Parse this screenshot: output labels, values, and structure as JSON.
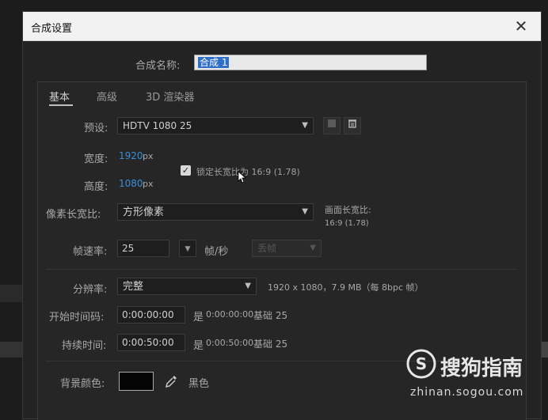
{
  "dialog": {
    "title": "合成设置",
    "close_symbol": "✕",
    "name_label": "合成名称:",
    "name_value": "合成 1"
  },
  "tabs": [
    {
      "label": "基本",
      "active": true
    },
    {
      "label": "高级",
      "active": false
    },
    {
      "label": "3D 渲染器",
      "active": false
    }
  ],
  "basic": {
    "preset_label": "预设:",
    "preset_value": "HDTV 1080 25",
    "width_label": "宽度:",
    "width_value": "1920",
    "height_label": "高度:",
    "height_value": "1080",
    "px": "px",
    "lock_checked": true,
    "lock_label": "锁定长宽比为 16:9 (1.78)",
    "pixel_aspect_label": "像素长宽比:",
    "pixel_aspect_value": "方形像素",
    "frame_aspect_label": "画面长宽比:",
    "frame_aspect_value": "16:9 (1.78)",
    "frame_rate_label": "帧速率:",
    "frame_rate_value": "25",
    "frame_rate_unit": "帧/秒",
    "drop_frame_value": "丢帧",
    "resolution_label": "分辨率:",
    "resolution_value": "完整",
    "resolution_info": "1920 x 1080，7.9 MB（每 8bpc 帧）",
    "start_tc_label": "开始时间码:",
    "start_tc_value": "0:00:00:00",
    "start_tc_info_is": "是",
    "start_tc_info_val": "0:00:00:00",
    "start_tc_base": "基础 25",
    "duration_label": "持续时间:",
    "duration_value": "0:00:50:00",
    "duration_info_is": "是",
    "duration_info_val": "0:00:50:00",
    "duration_base": "基础 25",
    "bg_color_label": "背景颜色:",
    "bg_color_hex": "#050505",
    "bg_color_name": "黑色"
  },
  "watermark": {
    "brand": "搜狗指南",
    "url": "zhinan.sogou.com"
  },
  "icons": [
    "close-icon",
    "chevron-down-icon",
    "save-preset-icon",
    "trash-icon",
    "eyedropper-icon",
    "checkmark-icon",
    "cursor-icon",
    "sogou-logo-icon"
  ]
}
